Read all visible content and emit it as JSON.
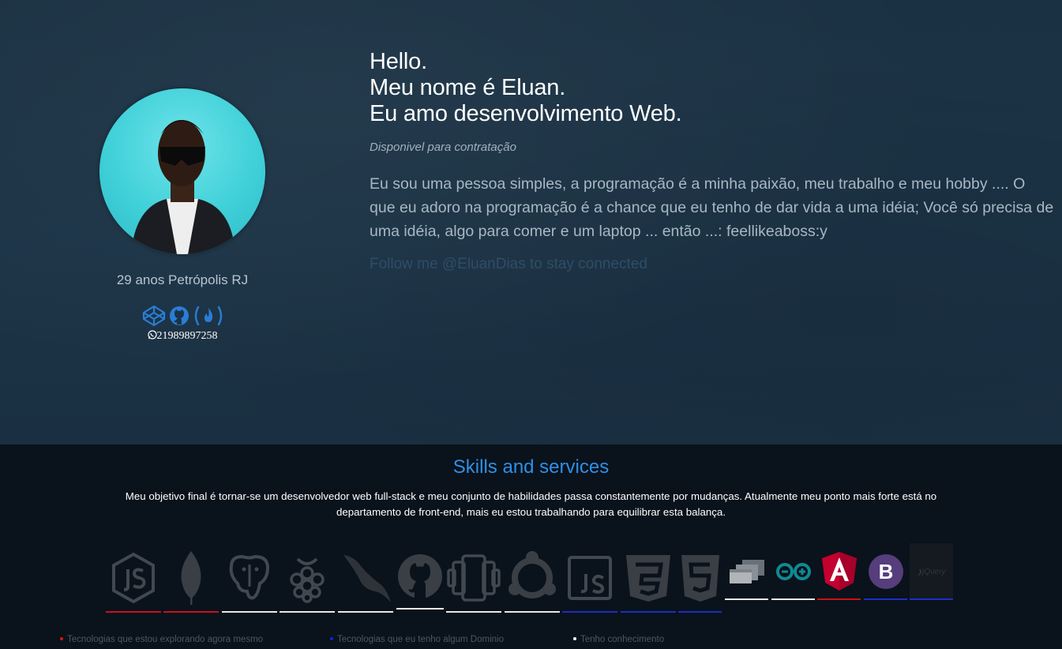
{
  "profile": {
    "age_location": "29 anos Petrópolis RJ",
    "phone": "21989897258",
    "socials": [
      {
        "name": "codepen",
        "icon": "codepen-icon"
      },
      {
        "name": "github",
        "icon": "github-icon"
      },
      {
        "name": "freecodecamp",
        "icon": "freecodecamp-icon"
      }
    ]
  },
  "headline": {
    "line1": "Hello.",
    "line2": "Meu nome é Eluan.",
    "line3": "Eu amo desenvolvimento Web."
  },
  "availability": "Disponivel para contratação",
  "bio": "Eu sou uma pessoa simples, a programação é a minha paixão, meu trabalho e meu hobby .... O que eu adoro na programação é a chance que eu tenho de dar vida a uma idéia; Você só precisa de uma idéia, algo para comer e um laptop ... então ...: feellikeaboss:y",
  "follow": "Follow me @EluanDias to stay connected",
  "skills": {
    "title": "Skills and services",
    "description": "Meu objetivo final é tornar-se um desenvolvedor web full-stack e meu conjunto de habilidades passa constantemente por mudanças. Atualmente meu ponto mais forte está no departamento de front-end, mais eu estou trabalhando para equilibrar esta balança.",
    "technologies": [
      {
        "icon": "nodejs-icon",
        "level": "exploring"
      },
      {
        "icon": "mongodb-icon",
        "level": "exploring"
      },
      {
        "icon": "postgresql-icon",
        "level": "knowledge"
      },
      {
        "icon": "raspberry-pi-icon",
        "level": "knowledge"
      },
      {
        "icon": "mysql-icon",
        "level": "knowledge"
      },
      {
        "icon": "github-icon",
        "level": "knowledge"
      },
      {
        "icon": "phonegap-icon",
        "level": "knowledge"
      },
      {
        "icon": "ubuntu-icon",
        "level": "knowledge"
      },
      {
        "icon": "javascript-icon",
        "level": "domain"
      },
      {
        "icon": "css3-icon",
        "level": "domain"
      },
      {
        "icon": "html5-icon",
        "level": "domain"
      },
      {
        "icon": "windows-forms-icon",
        "level": "knowledge"
      },
      {
        "icon": "arduino-icon",
        "level": "knowledge"
      },
      {
        "icon": "angular-icon",
        "level": "exploring"
      },
      {
        "icon": "bootstrap-icon",
        "level": "domain"
      },
      {
        "icon": "jquery-icon",
        "level": "domain",
        "label": "jQuery"
      }
    ]
  },
  "legend": [
    {
      "color": "#e01010",
      "label": "Tecnologias que estou explorando agora mesmo"
    },
    {
      "color": "#1020e8",
      "label": "Tecnologias que eu tenho algum Dominio"
    },
    {
      "color": "#ffffff",
      "label": "Tenho conhecimento"
    }
  ],
  "colors": {
    "exploring": "#c8131a",
    "domain": "#1b2fc4",
    "knowledge": "#e8e8e8",
    "accent": "#2e8fe8"
  }
}
